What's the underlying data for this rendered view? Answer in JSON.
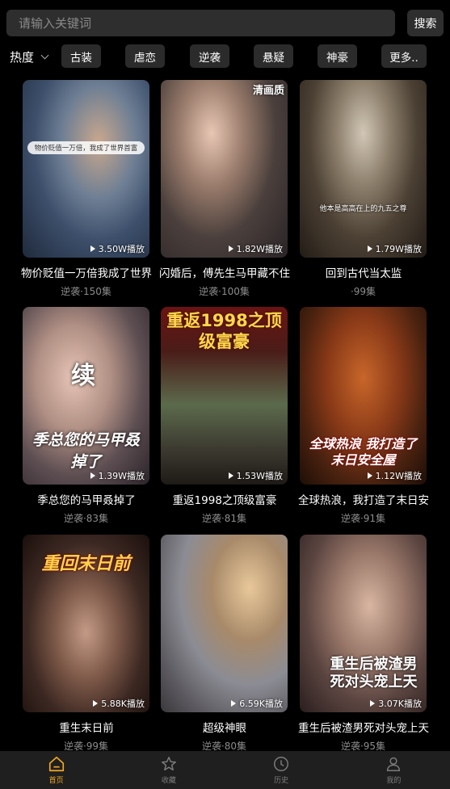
{
  "search": {
    "placeholder": "请输入关键词",
    "button_label": "搜索"
  },
  "filters": {
    "sort_label": "热度",
    "chips": [
      "古装",
      "虐恋",
      "逆袭",
      "悬疑",
      "神豪",
      "更多.."
    ]
  },
  "dramas": [
    {
      "title": "物价贬值一万倍我成了世界",
      "meta": "逆袭·150集",
      "plays": "3.50W播放",
      "poster_caption": "物价贬值一万倍，我成了世界首富"
    },
    {
      "title": "闪婚后，傅先生马甲藏不住",
      "meta": "逆袭·100集",
      "plays": "1.82W播放",
      "poster_caption": "清画质"
    },
    {
      "title": "回到古代当太监",
      "meta": "·99集",
      "plays": "1.79W播放",
      "poster_caption": "他本是高高在上的九五之尊"
    },
    {
      "title": "季总您的马甲叒掉了",
      "meta": "逆袭·83集",
      "plays": "1.39W播放",
      "poster_caption": "季总您的马甲叒掉了",
      "poster_badge": "续"
    },
    {
      "title": "重返1998之顶级富豪",
      "meta": "逆袭·81集",
      "plays": "1.53W播放",
      "poster_caption": "重返1998之顶级富豪"
    },
    {
      "title": "全球热浪，我打造了末日安",
      "meta": "逆袭·91集",
      "plays": "1.12W播放",
      "poster_caption": "全球热浪 我打造了末日安全屋"
    },
    {
      "title": "重生末日前",
      "meta": "逆袭·99集",
      "plays": "5.88K播放",
      "poster_caption": "重回末日前"
    },
    {
      "title": "超级神眼",
      "meta": "逆袭·80集",
      "plays": "6.59K播放",
      "poster_caption": ""
    },
    {
      "title": "重生后被渣男死对头宠上天",
      "meta": "逆袭·95集",
      "plays": "3.07K播放",
      "poster_caption": "重生后被渣男死对头宠上天"
    }
  ],
  "tabbar": [
    {
      "label": "首页",
      "icon": "home-icon",
      "active": true
    },
    {
      "label": "收藏",
      "icon": "star-icon",
      "active": false
    },
    {
      "label": "历史",
      "icon": "clock-icon",
      "active": false
    },
    {
      "label": "我的",
      "icon": "user-icon",
      "active": false
    }
  ],
  "colors": {
    "background": "#000000",
    "accent": "#f2a825",
    "surface": "#2e2e2e"
  }
}
